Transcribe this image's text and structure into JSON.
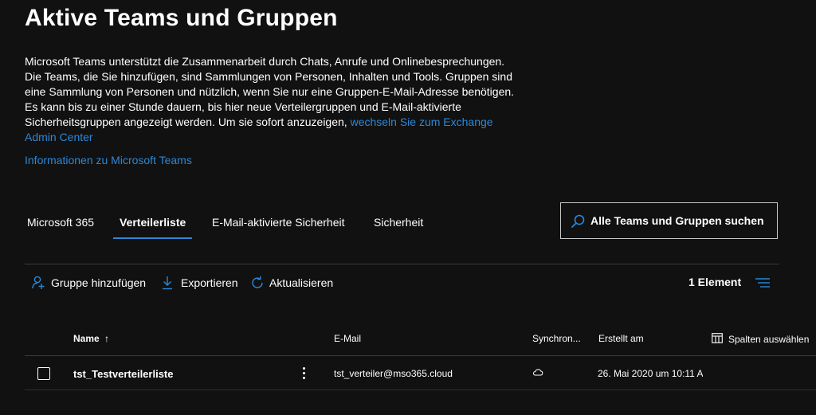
{
  "page": {
    "title": "Aktive Teams und Gruppen",
    "description_text": "Microsoft Teams unterstützt die Zusammenarbeit durch Chats, Anrufe und Onlinebesprechungen. Die Teams, die Sie hinzufügen, sind Sammlungen von Personen, Inhalten und Tools. Gruppen sind eine Sammlung von Personen und nützlich, wenn Sie nur eine Gruppen-E-Mail-Adresse benötigen. Es kann bis zu einer Stunde dauern, bis hier neue Verteilergruppen und E-Mail-aktivierte Sicherheitsgruppen angezeigt werden. Um sie sofort anzuzeigen, ",
    "exchange_link": "wechseln Sie zum Exchange Admin Center",
    "info_link": "Informationen zu Microsoft Teams"
  },
  "tabs": [
    {
      "label": "Microsoft 365",
      "active": false
    },
    {
      "label": "Verteilerliste",
      "active": true
    },
    {
      "label": "E-Mail-aktivierte Sicherheit",
      "active": false
    },
    {
      "label": "Sicherheit",
      "active": false
    }
  ],
  "search": {
    "placeholder": "Alle Teams und Gruppen suchen",
    "icon": "search-icon"
  },
  "toolbar": {
    "add_group": "Gruppe hinzufügen",
    "export": "Exportieren",
    "refresh": "Aktualisieren",
    "count": "1 Element"
  },
  "table": {
    "columns": {
      "name": "Name",
      "sort_indicator": "↑",
      "email": "E-Mail",
      "sync": "Synchron...",
      "created": "Erstellt am",
      "choose_columns": "Spalten auswählen"
    },
    "rows": [
      {
        "name": "tst_Testverteilerliste",
        "email": "tst_verteiler@mso365.cloud",
        "sync_icon": "cloud-icon",
        "created": "26. Mai 2020 um 10:11 A"
      }
    ]
  },
  "colors": {
    "background": "#111111",
    "accent": "#2b88d8",
    "text": "#ffffff"
  }
}
